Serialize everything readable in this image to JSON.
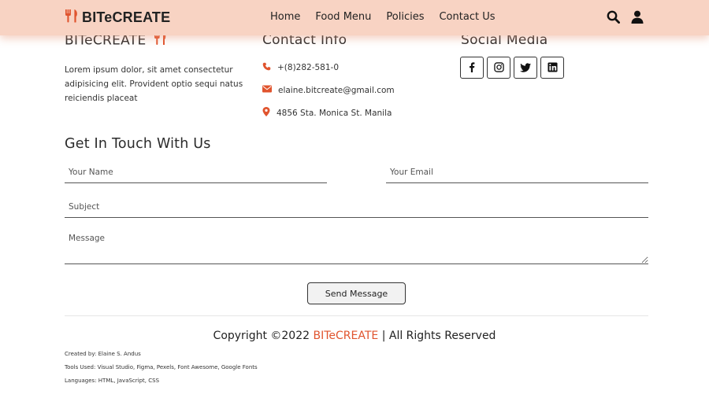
{
  "header": {
    "logo_text": "BITeCREATE",
    "nav": [
      "Home",
      "Food Menu",
      "Policies",
      "Contact Us"
    ],
    "icons": [
      "search-icon",
      "user-icon"
    ]
  },
  "footer": {
    "brand_heading": "BITeCREATE",
    "about_text": "Lorem ipsum dolor, sit amet consectetur adipisicing elit. Provident optio sequi natus reiciendis placeat",
    "contact_heading": "Contact Info",
    "phone": "+(8)282-581-0",
    "email": "elaine.bitcreate@gmail.com",
    "address": "4856 Sta. Monica St. Manila",
    "social_heading": "Social Media",
    "social_icons": [
      "facebook-icon",
      "instagram-icon",
      "twitter-icon",
      "linkedin-icon"
    ]
  },
  "form": {
    "title": "Get In Touch With Us",
    "name_placeholder": "Your Name",
    "email_placeholder": "Your Email",
    "subject_placeholder": "Subject",
    "message_placeholder": "Message",
    "send_label": "Send Message"
  },
  "copyright": {
    "prefix": "Copyright ©2022 ",
    "brand": "BITeCREATE",
    "suffix": " | All Rights Reserved"
  },
  "credits": {
    "created_by": "Created by: Elaine S. Andus",
    "tools": "Tools Used: Visual Studio, Figma, Pexels, Font Awesome, Google Fonts",
    "languages": "Languages: HTML, JavaScript, CSS"
  },
  "colors": {
    "accent": "#e0542e",
    "header_bg": "#f8d3c3"
  }
}
